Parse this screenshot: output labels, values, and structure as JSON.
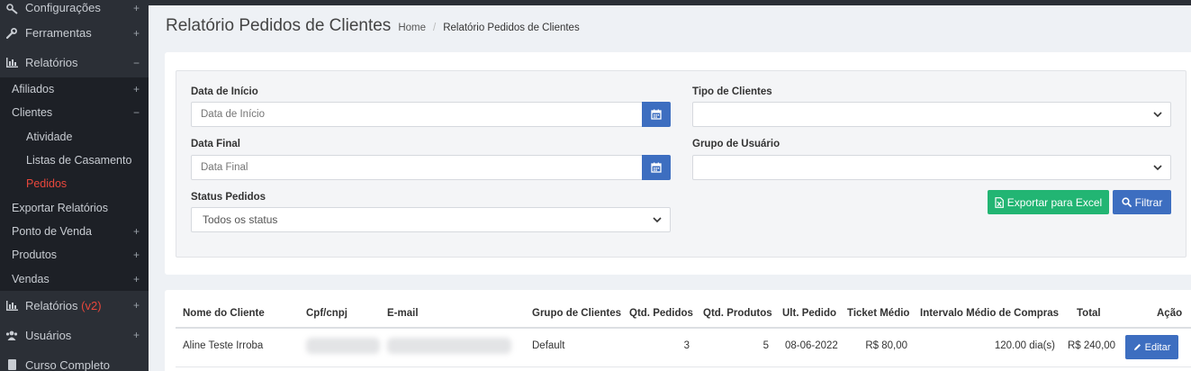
{
  "sidebar": {
    "items": [
      {
        "label": "Configurações",
        "toggle": "+",
        "icon": "wrench-gear-icon"
      },
      {
        "label": "Ferramentas",
        "toggle": "+",
        "icon": "wrench-icon"
      },
      {
        "label": "Relatórios",
        "toggle": "−",
        "icon": "bar-chart-icon"
      }
    ],
    "sub_items": [
      {
        "label": "Afiliados",
        "toggle": "+"
      },
      {
        "label": "Clientes",
        "toggle": "−"
      },
      {
        "label": "Atividade"
      },
      {
        "label": "Listas de Casamento"
      },
      {
        "label": "Pedidos"
      },
      {
        "label": "Exportar Relatórios"
      },
      {
        "label": "Ponto de Venda",
        "toggle": "+"
      },
      {
        "label": "Produtos",
        "toggle": "+"
      },
      {
        "label": "Vendas",
        "toggle": "+"
      }
    ],
    "bottom_items": [
      {
        "label": "Relatórios",
        "tag": "(v2)",
        "toggle": "+",
        "icon": "bar-chart-icon"
      },
      {
        "label": "Usuários",
        "toggle": "+",
        "icon": "users-icon"
      },
      {
        "label": "Curso Completo",
        "icon": "book-icon"
      }
    ],
    "active_color": "#e8473c"
  },
  "header": {
    "title": "Relatório Pedidos de Clientes",
    "breadcrumb_home": "Home",
    "breadcrumb_sep": "/",
    "breadcrumb_current": "Relatório Pedidos de Clientes"
  },
  "filters": {
    "start_label": "Data de Início",
    "start_placeholder": "Data de Início",
    "end_label": "Data Final",
    "end_placeholder": "Data Final",
    "status_label": "Status Pedidos",
    "status_value": "Todos os status",
    "client_type_label": "Tipo de Clientes",
    "client_type_value": "",
    "user_group_label": "Grupo de Usuário",
    "user_group_value": "",
    "export_button": "Exportar para Excel",
    "filter_button": "Filtrar"
  },
  "table": {
    "headers": [
      "Nome do Cliente",
      "Cpf/cnpj",
      "E-mail",
      "Grupo de Clientes",
      "Qtd. Pedidos",
      "Qtd. Produtos",
      "Ult. Pedido",
      "Ticket Médio",
      "Intervalo Médio de Compras",
      "Total",
      "Ação"
    ],
    "rows": [
      {
        "name": "Aline Teste Irroba",
        "group": "Default",
        "orders": "3",
        "products": "5",
        "last_order": "08-06-2022",
        "avg_ticket": "R$ 80,00",
        "avg_interval": "120.00 dia(s)",
        "total": "R$ 240,00",
        "action": "Editar"
      }
    ]
  },
  "colors": {
    "primary": "#3d6ec0",
    "success": "#22b573",
    "sidebar_bg": "#2b2f36"
  }
}
